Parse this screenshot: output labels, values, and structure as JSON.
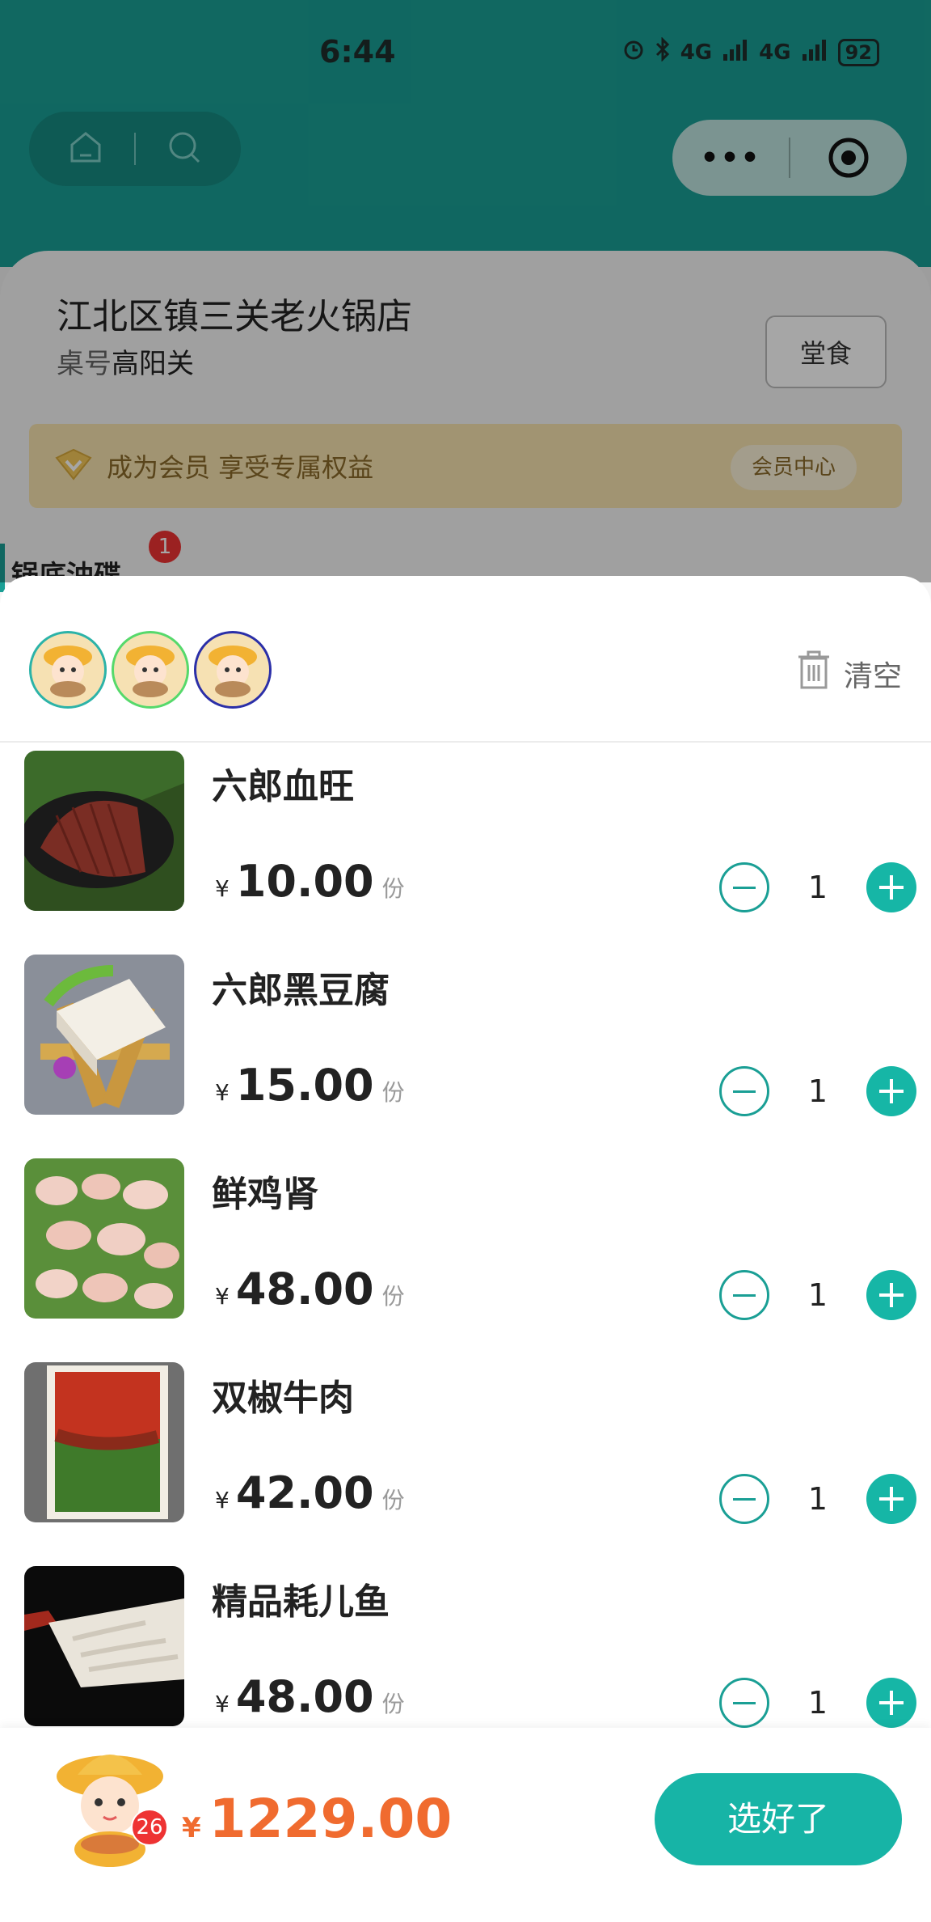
{
  "status_bar": {
    "time": "6:44",
    "signal_1": "4G",
    "signal_2": "4G",
    "battery": "92"
  },
  "store": {
    "name": "江北区镇三关老火锅店",
    "table_label": "桌号",
    "table_value": "高阳关",
    "dine_mode": "堂食",
    "member_text": "成为会员 享受专属权益",
    "member_center": "会员中心",
    "category": "锅底油碟",
    "category_badge": "1"
  },
  "cart": {
    "clear_label": "清空",
    "items": [
      {
        "name": "六郎血旺",
        "currency": "¥",
        "price": "10.00",
        "unit": "份",
        "qty": "1"
      },
      {
        "name": "六郎黑豆腐",
        "currency": "¥",
        "price": "15.00",
        "unit": "份",
        "qty": "1"
      },
      {
        "name": "鲜鸡肾",
        "currency": "¥",
        "price": "48.00",
        "unit": "份",
        "qty": "1"
      },
      {
        "name": "双椒牛肉",
        "currency": "¥",
        "price": "42.00",
        "unit": "份",
        "qty": "1"
      },
      {
        "name": "精品耗儿鱼",
        "currency": "¥",
        "price": "48.00",
        "unit": "份",
        "qty": "1"
      }
    ]
  },
  "footer": {
    "count_badge": "26",
    "currency": "¥",
    "total": "1229.00",
    "done_label": "选好了"
  },
  "colors": {
    "accent": "#17b4a6",
    "price_total": "#f06b2f",
    "badge": "#e33333"
  }
}
